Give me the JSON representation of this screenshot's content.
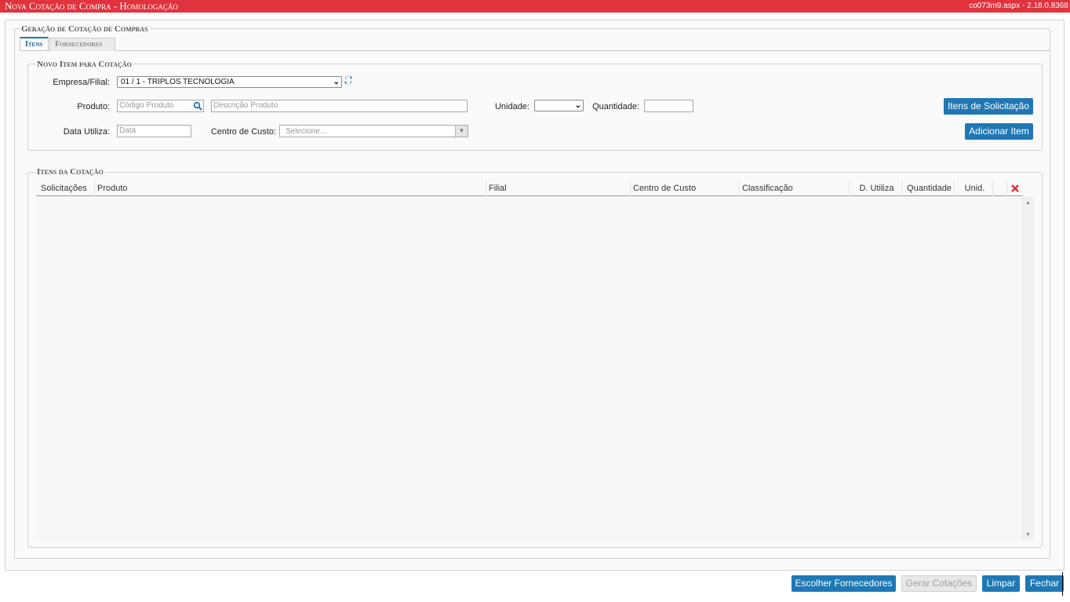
{
  "window": {
    "title": "Nova Cotação de Compra  - Homologação",
    "version": "co073m9.aspx - 2.18.0.8368"
  },
  "main_section": {
    "legend": "Geração de Cotação de Compras"
  },
  "tabs": [
    {
      "label": "Itens",
      "active": true
    },
    {
      "label": "Fornecedores",
      "active": false
    }
  ],
  "new_item": {
    "legend": "Novo Item para Cotação",
    "empresa_label": "Empresa/Filial:",
    "empresa_value": "01 / 1 - TRIPLOS TECNOLOGIA",
    "produto_label": "Produto:",
    "codigo_placeholder": "Código Produto",
    "descricao_placeholder": "Descrição Produto",
    "unidade_label": "Unidade:",
    "unidade_value": "",
    "quantidade_label": "Quantidade:",
    "quantidade_value": "",
    "data_label": "Data Utiliza:",
    "data_placeholder": "Data",
    "centro_label": "Centro de Custo:",
    "centro_placeholder": "Selecione...",
    "itens_solicitacao_button": "Itens de Solicitação",
    "adicionar_button": "Adicionar Item"
  },
  "items_grid": {
    "legend": "Itens da Cotação",
    "columns": [
      "Solicitações",
      "Produto",
      "Filial",
      "Centro de Custo",
      "Classificação",
      "D. Utiliza",
      "Quantidade",
      "Unid."
    ],
    "rows": []
  },
  "footer": {
    "escolher": "Escolher Fornecedores",
    "gerar": "Gerar Cotações",
    "limpar": "Limpar",
    "fechar": "Fechar"
  },
  "colors": {
    "titlebar": "#e0333d",
    "button": "#1f78b4",
    "delete_icon": "#e0333d"
  },
  "icons": [
    "search-icon",
    "refresh-icon",
    "delete-all-icon",
    "chevron-down-icon",
    "scroll-up-icon",
    "scroll-down-icon"
  ]
}
